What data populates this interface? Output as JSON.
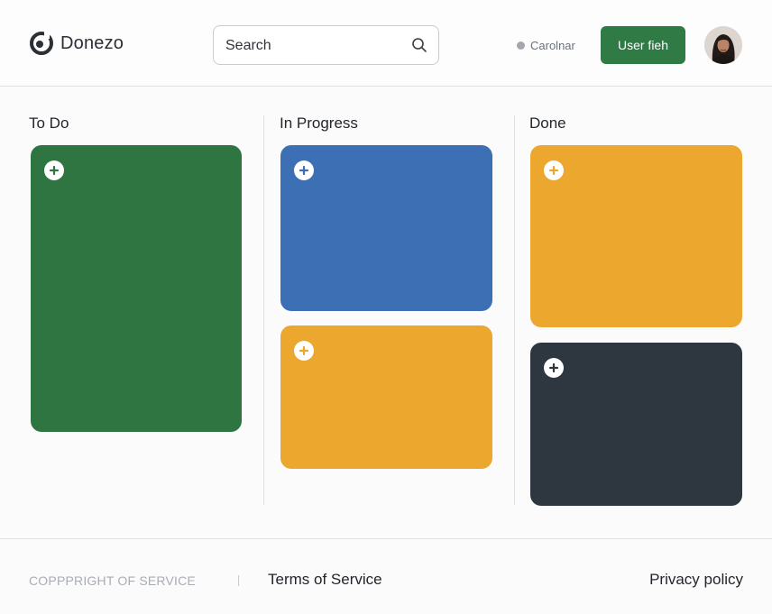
{
  "header": {
    "brand": "Donezo",
    "search": {
      "placeholder": "Search",
      "value": ""
    },
    "status_label": "Carolnar",
    "user_button_label": "User fieh"
  },
  "board": {
    "columns": [
      {
        "title": "To Do",
        "cards": [
          {
            "color": "#2e7541",
            "icon": "plus-icon"
          }
        ]
      },
      {
        "title": "In Progress",
        "cards": [
          {
            "color": "#3c6fb4",
            "icon": "plus-icon"
          },
          {
            "color": "#eba72e",
            "icon": "plus-icon"
          }
        ]
      },
      {
        "title": "Done",
        "cards": [
          {
            "color": "#eba72e",
            "icon": "plus-icon"
          },
          {
            "color": "#2e3740",
            "icon": "plus-icon"
          }
        ]
      }
    ]
  },
  "footer": {
    "copyright": "COPPPRIGHT OF SERVICE",
    "terms": "Terms of Service",
    "privacy": "Privacy policy"
  },
  "colors": {
    "accent_green": "#2f7a45",
    "blue": "#3c6fb4",
    "amber": "#eba72e",
    "slate": "#2e3740"
  }
}
